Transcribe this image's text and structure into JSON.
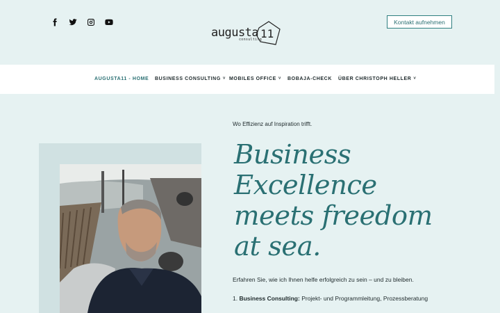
{
  "header": {
    "social": [
      {
        "icon": "facebook-icon"
      },
      {
        "icon": "twitter-icon"
      },
      {
        "icon": "instagram-icon"
      },
      {
        "icon": "youtube-icon"
      }
    ],
    "logo": {
      "word": "augusta",
      "number": "11",
      "sub": "consulting"
    },
    "cta_label": "Kontakt aufnehmen"
  },
  "nav": {
    "items": [
      {
        "label": "AUGUSTA11 - HOME",
        "active": true
      },
      {
        "label": "BUSINESS CONSULTING",
        "dropdown": true
      },
      {
        "label": "MOBILES OFFICE",
        "dropdown": true
      },
      {
        "label": "BOBAJA-CHECK"
      },
      {
        "label": "ÜBER CHRISTOPH HELLER",
        "dropdown": true
      }
    ],
    "chevron": "˅"
  },
  "hero": {
    "tagline": "Wo Effizienz auf Inspiration trifft.",
    "headline_lines": [
      "Business",
      "Excellence",
      "meets freedom",
      "at sea."
    ],
    "intro": "Erfahren Sie, wie ich Ihnen helfe erfolgreich zu sein – und zu bleiben.",
    "point1_prefix": "1. ",
    "point1_bold": "Business Consulting:",
    "point1_text": " Projekt- und Programmleitung, Prozessberatung"
  },
  "colors": {
    "accent": "#2a7073",
    "background": "#e6f2f2",
    "frame": "#d0e1e2"
  }
}
